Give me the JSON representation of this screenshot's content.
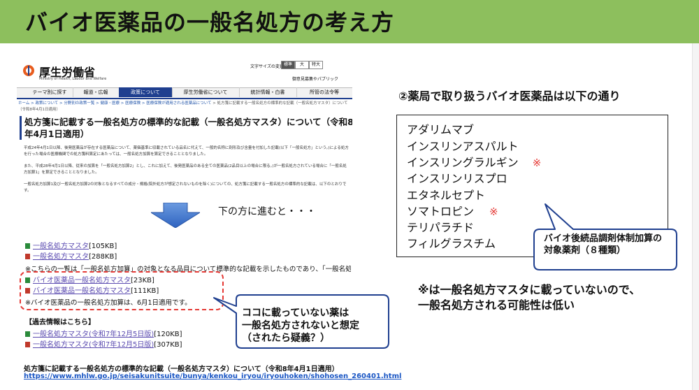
{
  "slide": {
    "title": "バイオ医薬品の一般名処方の考え方"
  },
  "mhlw": {
    "site_name": "厚生労働省",
    "site_name_en": "Ministry of Health, Labour and Welfare",
    "font_size_label": "文字サイズの変更",
    "font_size_options": [
      "標準",
      "大",
      "特大"
    ],
    "press_link": "御意見募集やパブリック",
    "nav": [
      "テーマ別に探す",
      "報道・広報",
      "政策について",
      "厚生労働省について",
      "統計情報・白書",
      "所管の法令等"
    ],
    "nav_active": "政策について",
    "breadcrumb_links": "ホーム > 政策について > 分野別の政策一覧 > 健康・医療 > 医療保険 > 医療保険が適用される医薬品について",
    "breadcrumb_rest": " > 処方箋に記載する一般名処方の標準的な記載（一般名処方マスタ）について（令和8年4月1日適用）",
    "page_heading": "処方箋に記載する一般名処方の標準的な記載（一般名処方マスタ）について（令和8年4月1日適用）",
    "para1": "平成24年4月1日以降、後発医薬品が存在する医薬品について、薬価基準に収載されている品名に代えて、一般的名称に剤形及び含量を付加した記載(以下「一般名処方」という。)による処方を行った場合の医療機関での処方箋料算定にあたっては、一般名処方加算を算定できることとなりました。",
    "para2": "また、平成28年4月1日以降、従来の加算を「一般名処方加算2」とし、これに加えて、後発医薬品のある全ての医薬品(2品目以上の場合に限る。)が一般名処方されている場合に「一般名処方加算1」を算定できることとなりました。",
    "para3": "一般名処方加算1及び一般名処方加算2の対象となるすべての成分・規格(院外処方が想定されないものを除く)についての、処方箋に記載する一般名処方の標準的な記載は、以下のとおりです。"
  },
  "arrow_note": "下の方に進むと・・・",
  "files": [
    {
      "label": "一般名処方マスタ",
      "size": "[105KB]",
      "kind": "excel"
    },
    {
      "label": "一般名処方マスタ",
      "size": "[288KB]",
      "kind": "pdf"
    }
  ],
  "note_general": "※こちらの一覧は「一般名処方加算」の対象となる品目について標準的な記載を示したものであり、「一般名処方」の可否",
  "bio_files": [
    {
      "label": "バイオ医薬品一般名処方マスタ",
      "size": "[23KB]",
      "kind": "excel"
    },
    {
      "label": "バイオ医薬品一般名処方マスタ",
      "size": "[111KB]",
      "kind": "pdf"
    }
  ],
  "note_bio": "※バイオ医薬品の一般名処方加算は、6月1日適用です。",
  "past_info": "【過去情報はこちら】",
  "past_files": [
    {
      "label": "一般名処方マスタ(令和7年12月5日版)",
      "size": "[120KB]",
      "kind": "excel"
    },
    {
      "label": "一般名処方マスタ(令和7年12月5日版)",
      "size": "[307KB]",
      "kind": "pdf"
    }
  ],
  "callout_left": {
    "line1": "ココに載っていない薬は",
    "line2": "一般名処方されないと想定",
    "line3": "（されたら疑義？）"
  },
  "pharmacy": {
    "heading": "②薬局で取り扱うバイオ医薬品は以下の通り",
    "drugs": [
      {
        "name": "アダリムマブ",
        "mark": ""
      },
      {
        "name": "インスリンアスパルト",
        "mark": ""
      },
      {
        "name": "インスリングラルギン",
        "mark": "※"
      },
      {
        "name": "インスリンリスプロ",
        "mark": ""
      },
      {
        "name": "エタネルセプト",
        "mark": ""
      },
      {
        "name": "ソマトロピン",
        "mark": "※"
      },
      {
        "name": "テリパラチド",
        "mark": ""
      },
      {
        "name": "フィルグラスチム",
        "mark": ""
      }
    ]
  },
  "callout_right": {
    "line1": "バイオ後続品調剤体制加算の",
    "line2": "対象薬剤（８種類）"
  },
  "conclusion": {
    "line1": "※は一般名処方マスタに載っていないので、",
    "line2": "一般名処方される可能性は低い"
  },
  "source": {
    "title": "処方箋に記載する一般名処方の標準的な記載（一般名処方マスタ）について（令和8年4月1日適用）",
    "url": "https://www.mhlw.go.jp/seisakunitsuite/bunya/kenkou_iryou/iryouhoken/shohosen_260401.html"
  },
  "colors": {
    "title_bar": "#8dbf5d",
    "callout_border": "#1f3f8f",
    "alert_red": "#e53935",
    "link_blue": "#1a56c4"
  }
}
